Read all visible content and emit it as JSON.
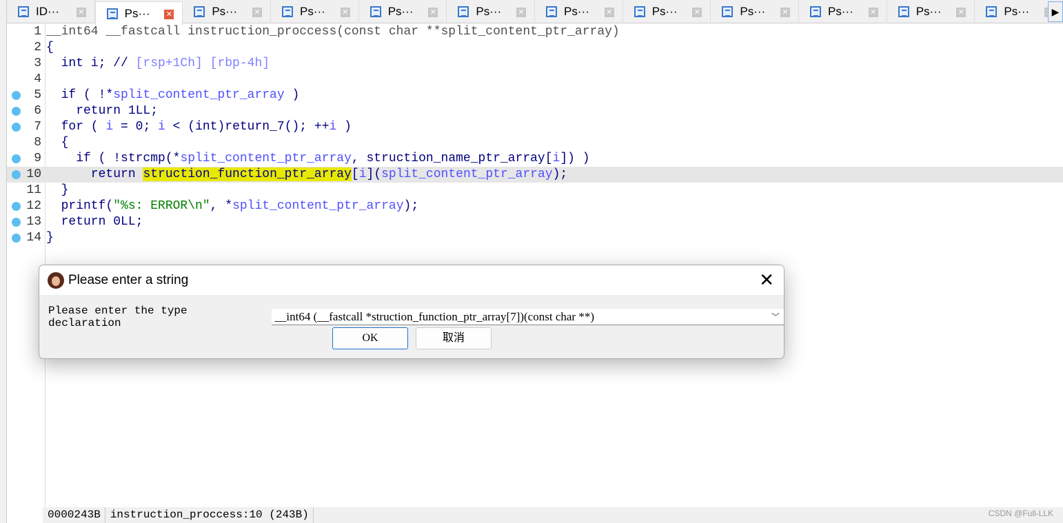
{
  "tabs": [
    {
      "label": "ID···"
    },
    {
      "label": "Ps···",
      "active": true
    },
    {
      "label": "Ps···"
    },
    {
      "label": "Ps···"
    },
    {
      "label": "Ps···"
    },
    {
      "label": "Ps···"
    },
    {
      "label": "Ps···"
    },
    {
      "label": "Ps···"
    },
    {
      "label": "Ps···"
    },
    {
      "label": "Ps···"
    },
    {
      "label": "Ps···"
    },
    {
      "label": "Ps···"
    }
  ],
  "code": [
    {
      "n": "1",
      "bp": false,
      "t": [
        [
          "__int64 __fastcall instruction_proccess(const char **split_content_ptr_array)",
          "d"
        ]
      ]
    },
    {
      "n": "2",
      "bp": false,
      "t": [
        [
          "{",
          "k"
        ]
      ]
    },
    {
      "n": "3",
      "bp": false,
      "t": [
        [
          "  int i; // ",
          "k"
        ],
        [
          "[rsp+1Ch] [rbp-4h]",
          "c"
        ]
      ]
    },
    {
      "n": "4",
      "bp": false,
      "t": []
    },
    {
      "n": "5",
      "bp": true,
      "t": [
        [
          "  if ( !*",
          "k"
        ],
        [
          "split_content_ptr_array",
          "v"
        ],
        [
          " )",
          "k"
        ]
      ]
    },
    {
      "n": "6",
      "bp": true,
      "t": [
        [
          "    return 1LL;",
          "k"
        ]
      ]
    },
    {
      "n": "7",
      "bp": true,
      "t": [
        [
          "  for ( ",
          "k"
        ],
        [
          "i",
          "v"
        ],
        [
          " = 0; ",
          "k"
        ],
        [
          "i",
          "v"
        ],
        [
          " < (int)return_7(); ++",
          "k"
        ],
        [
          "i",
          "v"
        ],
        [
          " )",
          "k"
        ]
      ]
    },
    {
      "n": "8",
      "bp": false,
      "t": [
        [
          "  {",
          "k"
        ]
      ]
    },
    {
      "n": "9",
      "bp": true,
      "t": [
        [
          "    if ( !strcmp(*",
          "k"
        ],
        [
          "split_content_ptr_array",
          "v"
        ],
        [
          ", struction_name_ptr_array[",
          "k"
        ],
        [
          "i",
          "v"
        ],
        [
          "]) )",
          "k"
        ]
      ]
    },
    {
      "n": "10",
      "bp": true,
      "hl": true,
      "t": [
        [
          "      return ",
          "k"
        ],
        [
          "struction_function_ptr_array",
          "h"
        ],
        [
          "[",
          "k"
        ],
        [
          "i",
          "v"
        ],
        [
          "](",
          "k"
        ],
        [
          "split_content_ptr_array",
          "v"
        ],
        [
          ");",
          "k"
        ]
      ]
    },
    {
      "n": "11",
      "bp": false,
      "t": [
        [
          "  }",
          "k"
        ]
      ]
    },
    {
      "n": "12",
      "bp": true,
      "t": [
        [
          "  printf(",
          "k"
        ],
        [
          "\"%s: ERROR\\n\"",
          "s"
        ],
        [
          ", *",
          "k"
        ],
        [
          "split_content_ptr_array",
          "v"
        ],
        [
          ");",
          "k"
        ]
      ]
    },
    {
      "n": "13",
      "bp": true,
      "t": [
        [
          "  return 0LL;",
          "k"
        ]
      ]
    },
    {
      "n": "14",
      "bp": true,
      "t": [
        [
          "}",
          "k"
        ]
      ]
    }
  ],
  "dialog": {
    "title": "Please enter a string",
    "prompt": "Please enter the type declaration",
    "value": "__int64 (__fastcall *struction_function_ptr_array[7])(const char **)",
    "ok": "OK",
    "cancel": "取消"
  },
  "status": {
    "address": "0000243B",
    "location": "instruction_proccess:10 (243B)"
  },
  "watermark": "CSDN @Full-LLK"
}
